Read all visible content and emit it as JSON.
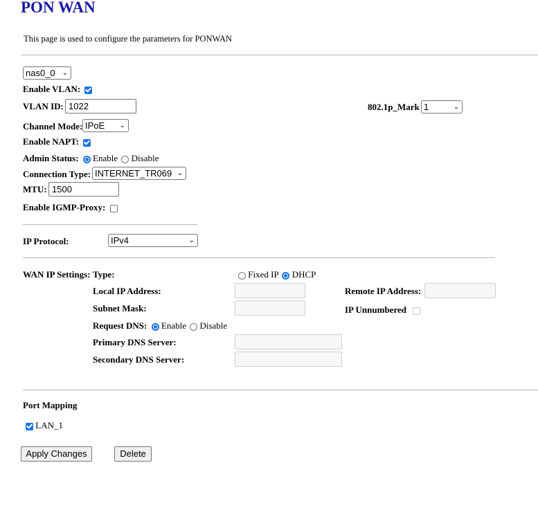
{
  "page": {
    "title": "PON WAN",
    "description": "This page is used to configure the parameters for PONWAN"
  },
  "interface_select": {
    "value": "nas0_0"
  },
  "vlan": {
    "enable_label": "Enable VLAN:",
    "enable_checked": true,
    "id_label": "VLAN ID:",
    "id_value": "1022",
    "mark_label": "802.1p_Mark",
    "mark_value": "1"
  },
  "channel_mode": {
    "label": "Channel Mode:",
    "value": "IPoE"
  },
  "napt": {
    "label": "Enable NAPT:",
    "checked": true
  },
  "admin_status": {
    "label": "Admin Status:",
    "options": [
      "Enable",
      "Disable"
    ],
    "selected": "Enable"
  },
  "connection_type": {
    "label": "Connection Type:",
    "value": "INTERNET_TR069"
  },
  "mtu": {
    "label": "MTU:",
    "value": "1500"
  },
  "igmp_proxy": {
    "label": "Enable IGMP-Proxy:",
    "checked": false
  },
  "ip_protocol": {
    "label": "IP Protocol:",
    "value": "IPv4"
  },
  "wan_ip": {
    "section_label": "WAN IP Settings:",
    "type_label": "Type:",
    "type_options": [
      "Fixed IP",
      "DHCP"
    ],
    "type_selected": "DHCP",
    "local_ip_label": "Local IP Address:",
    "local_ip_value": "",
    "remote_ip_label": "Remote IP Address:",
    "remote_ip_value": "",
    "subnet_mask_label": "Subnet Mask:",
    "subnet_mask_value": "",
    "ip_unnumbered_label": "IP Unnumbered",
    "ip_unnumbered_checked": false,
    "request_dns_label": "Request DNS:",
    "request_dns_options": [
      "Enable",
      "Disable"
    ],
    "request_dns_selected": "Enable",
    "primary_dns_label": "Primary DNS Server:",
    "primary_dns_value": "",
    "secondary_dns_label": "Secondary DNS Server:",
    "secondary_dns_value": ""
  },
  "port_mapping": {
    "label": "Port Mapping",
    "ports": [
      {
        "label": "LAN_1",
        "checked": true
      }
    ]
  },
  "buttons": {
    "apply": "Apply Changes",
    "delete": "Delete"
  },
  "colors": {
    "title": "#1a1aa6",
    "accent": "#1a73e8",
    "divider": "#b8b8b8"
  }
}
